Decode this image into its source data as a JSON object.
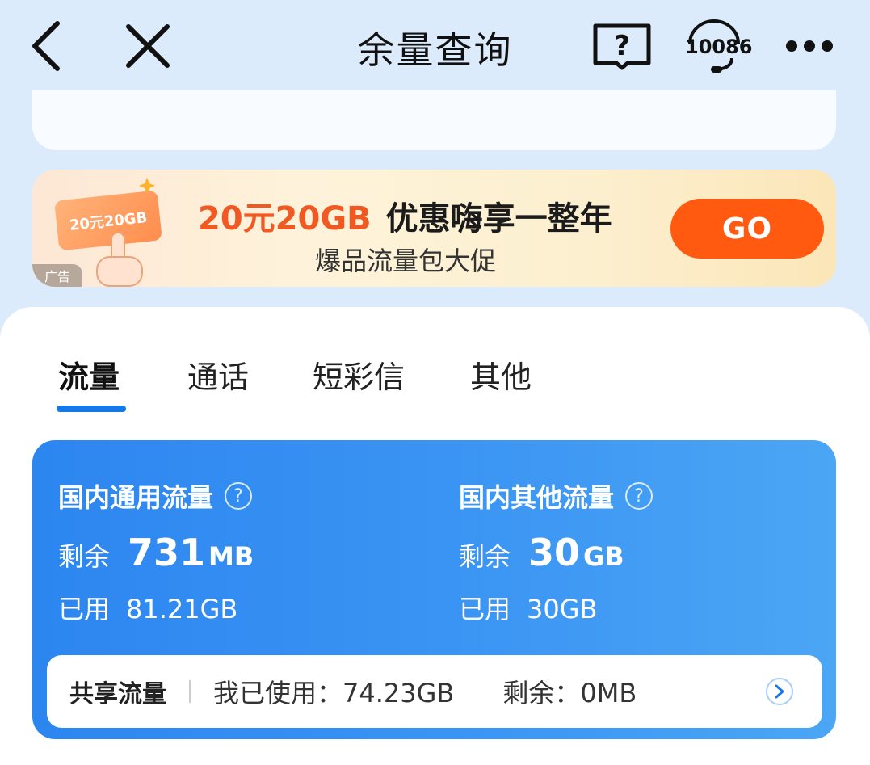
{
  "header": {
    "title": "余量查询",
    "back_icon": "chevron-left-icon",
    "close_icon": "close-icon",
    "help_icon": "help-book-icon",
    "hotline_label": "10086",
    "more_icon": "more-dots-icon"
  },
  "ad": {
    "coupon_text": "20元20GB",
    "badge": "广告",
    "headline_part1": "20元20GB",
    "headline_part2": "优惠嗨享一整年",
    "subline": "爆品流量包大促",
    "go_label": "GO"
  },
  "tabs": [
    {
      "label": "流量",
      "active": true
    },
    {
      "label": "通话",
      "active": false
    },
    {
      "label": "短彩信",
      "active": false
    },
    {
      "label": "其他",
      "active": false
    }
  ],
  "data_card": {
    "domestic_general": {
      "title": "国内通用流量",
      "remain_label": "剩余",
      "remain_value": "731",
      "remain_unit": "MB",
      "used_label": "已用",
      "used_value": "81.21GB"
    },
    "domestic_other": {
      "title": "国内其他流量",
      "remain_label": "剩余",
      "remain_value": "30",
      "remain_unit": "GB",
      "used_label": "已用",
      "used_value": "30GB"
    },
    "shared": {
      "title": "共享流量",
      "used_text": "我已使用：74.23GB",
      "remain_text": "剩余：0MB"
    }
  },
  "colors": {
    "background": "#dcebfb",
    "accent_blue": "#1677e6",
    "card_blue": "#3b95f3",
    "go_orange": "#ff5a10",
    "headline_orange": "#f05a22"
  }
}
